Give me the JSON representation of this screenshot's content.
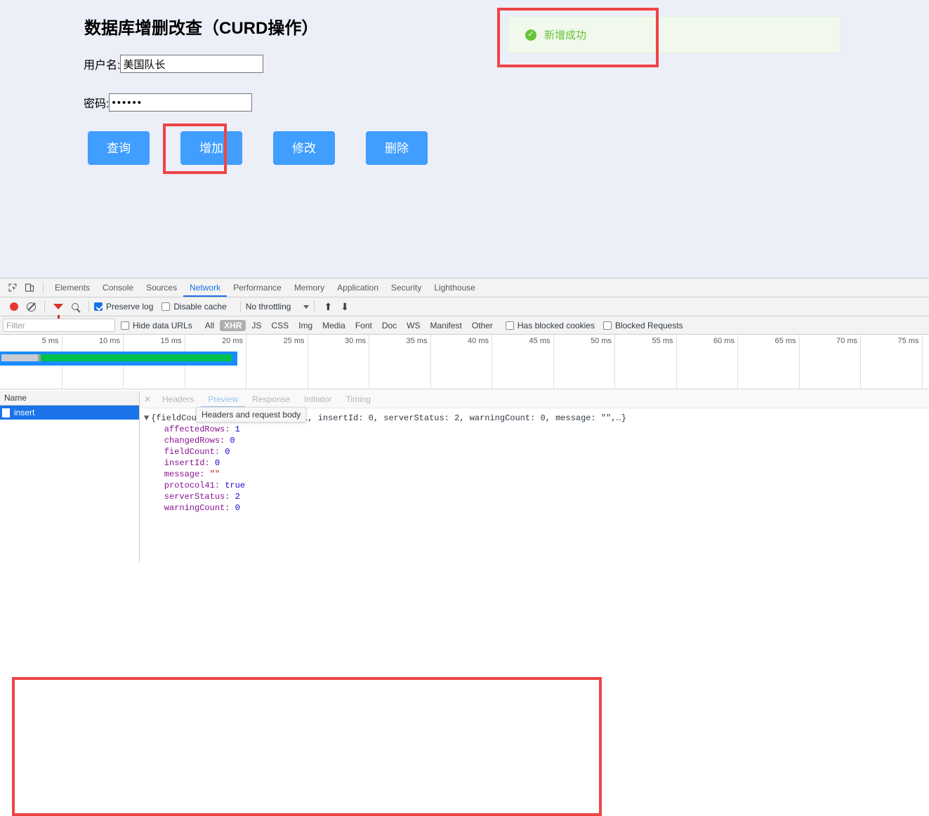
{
  "page": {
    "title": "数据库增删改查（CURD操作）",
    "form": {
      "username_label": "用户名:",
      "username_value": "美国队长",
      "password_label": "密码:",
      "password_value": "••••••"
    },
    "buttons": [
      {
        "label": "查询",
        "name": "query-button"
      },
      {
        "label": "增加",
        "name": "add-button"
      },
      {
        "label": "修改",
        "name": "update-button"
      },
      {
        "label": "删除",
        "name": "delete-button"
      }
    ],
    "message": {
      "text": "新增成功",
      "icon": "check-circle-icon",
      "color": "#67c23a",
      "background": "#f0f9eb"
    },
    "background": "#eceef8",
    "accent": "#409eff",
    "annotation_color": "#ef4444"
  },
  "devtools": {
    "main_tabs": [
      "Elements",
      "Console",
      "Sources",
      "Network",
      "Performance",
      "Memory",
      "Application",
      "Security",
      "Lighthouse"
    ],
    "active_main_tab": "Network",
    "network_toolbar": {
      "record_tooltip": "record-button",
      "clear_tooltip": "clear-button",
      "filter_tooltip": "filter-button",
      "search_tooltip": "search-button",
      "preserve_log": "Preserve log",
      "preserve_log_checked": true,
      "disable_cache": "Disable cache",
      "disable_cache_checked": false,
      "throttling": "No throttling"
    },
    "filter_bar": {
      "filter_placeholder": "Filter",
      "filter_value": "",
      "hide_data_urls": "Hide data URLs",
      "hide_data_urls_checked": false,
      "types": [
        "All",
        "XHR",
        "JS",
        "CSS",
        "Img",
        "Media",
        "Font",
        "Doc",
        "WS",
        "Manifest",
        "Other"
      ],
      "selected_type": "XHR",
      "has_blocked_cookies": "Has blocked cookies",
      "has_blocked_cookies_checked": false,
      "blocked_requests": "Blocked Requests",
      "blocked_requests_checked": false
    },
    "timeline": {
      "ticks": [
        "5 ms",
        "10 ms",
        "15 ms",
        "20 ms",
        "25 ms",
        "30 ms",
        "35 ms",
        "40 ms",
        "45 ms",
        "50 ms",
        "55 ms",
        "60 ms",
        "65 ms",
        "70 ms",
        "75 ms"
      ]
    },
    "requests": {
      "column_header": "Name",
      "rows": [
        {
          "name": "insert",
          "selected": true
        }
      ]
    },
    "detail_tabs": [
      "Headers",
      "Preview",
      "Response",
      "Initiator",
      "Timing"
    ],
    "active_detail_tab": "Preview",
    "tooltip": "Headers and request body",
    "preview": {
      "summary_prefix": "{fieldCount: 0, affectedRows: 1, insertId: 0, serverStatus: 2, warningCount: 0, message: \"\",…}",
      "entries": [
        {
          "key": "affectedRows",
          "value": "1",
          "type": "num"
        },
        {
          "key": "changedRows",
          "value": "0",
          "type": "num"
        },
        {
          "key": "fieldCount",
          "value": "0",
          "type": "num"
        },
        {
          "key": "insertId",
          "value": "0",
          "type": "num"
        },
        {
          "key": "message",
          "value": "\"\"",
          "type": "str"
        },
        {
          "key": "protocol41",
          "value": "true",
          "type": "bool"
        },
        {
          "key": "serverStatus",
          "value": "2",
          "type": "num"
        },
        {
          "key": "warningCount",
          "value": "0",
          "type": "num"
        }
      ]
    }
  }
}
